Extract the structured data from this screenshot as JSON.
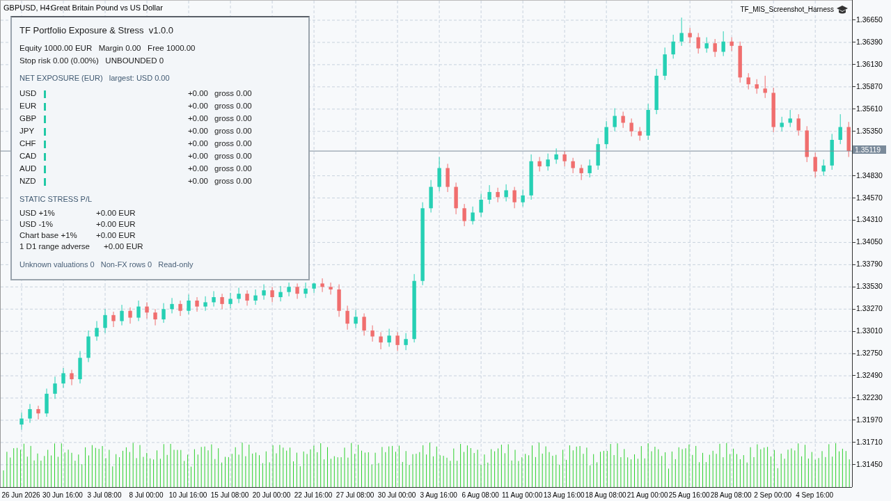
{
  "chart_header": {
    "symbol": "GBPUSD, H4:",
    "description": "Great Britain Pound vs US Dollar"
  },
  "expert": {
    "name": "TF_MIS_Screenshot_Harness"
  },
  "panel": {
    "title": "TF Portfolio Exposure & Stress  v1.0.0",
    "account_lines": [
      "Equity 1000.00 EUR   Margin 0.00   Free 1000.00",
      "Stop risk 0.00 (0.00%)   UNBOUNDED 0"
    ],
    "exposure_heading": "NET EXPOSURE (EUR)   largest: USD 0.00",
    "exposure_rows": [
      {
        "currency": "USD",
        "net": "+0.00",
        "gross": "gross 0.00"
      },
      {
        "currency": "EUR",
        "net": "+0.00",
        "gross": "gross 0.00"
      },
      {
        "currency": "GBP",
        "net": "+0.00",
        "gross": "gross 0.00"
      },
      {
        "currency": "JPY",
        "net": "+0.00",
        "gross": "gross 0.00"
      },
      {
        "currency": "CHF",
        "net": "+0.00",
        "gross": "gross 0.00"
      },
      {
        "currency": "CAD",
        "net": "+0.00",
        "gross": "gross 0.00"
      },
      {
        "currency": "AUD",
        "net": "+0.00",
        "gross": "gross 0.00"
      },
      {
        "currency": "NZD",
        "net": "+0.00",
        "gross": "gross 0.00"
      }
    ],
    "stress_heading": "STATIC STRESS P/L",
    "stress_rows": [
      {
        "scenario": "USD +1%",
        "pl": "+0.00 EUR"
      },
      {
        "scenario": "USD -1%",
        "pl": "+0.00 EUR"
      },
      {
        "scenario": "Chart base +1%",
        "pl": "+0.00 EUR"
      },
      {
        "scenario": "1 D1 range adverse",
        "pl": "+0.00 EUR"
      }
    ],
    "footer": "Unknown valuations 0   Non-FX rows 0   Read-only"
  },
  "chart_data": {
    "type": "candlestick",
    "categories": [
      "26 Jun 2026",
      null,
      null,
      null,
      null,
      "30 Jun 16:00",
      null,
      null,
      null,
      null,
      "3 Jul 08:00",
      null,
      null,
      null,
      null,
      "8 Jul 00:00",
      null,
      null,
      null,
      null,
      "10 Jul 16:00",
      null,
      null,
      null,
      null,
      "15 Jul 08:00",
      null,
      null,
      null,
      null,
      "20 Jul 00:00",
      null,
      null,
      null,
      null,
      "22 Jul 16:00",
      null,
      null,
      null,
      null,
      "27 Jul 08:00",
      null,
      null,
      null,
      null,
      "30 Jul 00:00",
      null,
      null,
      null,
      null,
      "3 Aug 16:00",
      null,
      null,
      null,
      null,
      "6 Aug 08:00",
      null,
      null,
      null,
      null,
      "11 Aug 00:00",
      null,
      null,
      null,
      null,
      "13 Aug 16:00",
      null,
      null,
      null,
      null,
      "18 Aug 08:00",
      null,
      null,
      null,
      null,
      "21 Aug 00:00",
      null,
      null,
      null,
      null,
      "25 Aug 16:00",
      null,
      null,
      null,
      null,
      "28 Aug 08:00",
      null,
      null,
      null,
      null,
      "2 Sep 00:00",
      null,
      null,
      null,
      null,
      "4 Sep 16:00",
      null,
      null,
      null,
      null
    ],
    "ohlc": [
      [
        1.3192,
        1.3206,
        1.3186,
        1.3199
      ],
      [
        1.3199,
        1.3216,
        1.3194,
        1.321
      ],
      [
        1.321,
        1.3214,
        1.3198,
        1.3205
      ],
      [
        1.3205,
        1.3234,
        1.3201,
        1.3228
      ],
      [
        1.3228,
        1.3248,
        1.3222,
        1.324
      ],
      [
        1.324,
        1.3258,
        1.3235,
        1.3252
      ],
      [
        1.3252,
        1.3256,
        1.3238,
        1.3245
      ],
      [
        1.3245,
        1.3278,
        1.324,
        1.327
      ],
      [
        1.327,
        1.3302,
        1.3265,
        1.3295
      ],
      [
        1.3295,
        1.3313,
        1.329,
        1.3305
      ],
      [
        1.3305,
        1.3327,
        1.3299,
        1.332
      ],
      [
        1.332,
        1.3324,
        1.3306,
        1.3313
      ],
      [
        1.3313,
        1.3332,
        1.3308,
        1.3325
      ],
      [
        1.3325,
        1.3329,
        1.331,
        1.3317
      ],
      [
        1.3317,
        1.3337,
        1.3313,
        1.333
      ],
      [
        1.333,
        1.3335,
        1.3316,
        1.3323
      ],
      [
        1.3323,
        1.3327,
        1.3308,
        1.3315
      ],
      [
        1.3315,
        1.3334,
        1.3311,
        1.3327
      ],
      [
        1.3327,
        1.334,
        1.3322,
        1.3333
      ],
      [
        1.3333,
        1.3337,
        1.3319,
        1.3325
      ],
      [
        1.3325,
        1.3344,
        1.3321,
        1.3337
      ],
      [
        1.3337,
        1.3341,
        1.3324,
        1.333
      ],
      [
        1.333,
        1.3342,
        1.3325,
        1.3335
      ],
      [
        1.3335,
        1.3348,
        1.333,
        1.3341
      ],
      [
        1.3341,
        1.3345,
        1.3327,
        1.3333
      ],
      [
        1.3333,
        1.3346,
        1.3328,
        1.3339
      ],
      [
        1.3339,
        1.3352,
        1.3334,
        1.3345
      ],
      [
        1.3345,
        1.3349,
        1.3331,
        1.3337
      ],
      [
        1.3337,
        1.335,
        1.3332,
        1.3343
      ],
      [
        1.3343,
        1.3356,
        1.3338,
        1.3349
      ],
      [
        1.3349,
        1.3353,
        1.3335,
        1.3341
      ],
      [
        1.3341,
        1.3354,
        1.3336,
        1.3347
      ],
      [
        1.3347,
        1.3358,
        1.3342,
        1.3353
      ],
      [
        1.3353,
        1.3357,
        1.3339,
        1.3345
      ],
      [
        1.3345,
        1.3358,
        1.334,
        1.3351
      ],
      [
        1.3351,
        1.3358,
        1.3346,
        1.3357
      ],
      [
        1.3357,
        1.3363,
        1.3347,
        1.3353
      ],
      [
        1.3353,
        1.3358,
        1.3344,
        1.335
      ],
      [
        1.335,
        1.3356,
        1.3318,
        1.3325
      ],
      [
        1.3325,
        1.3331,
        1.3303,
        1.331
      ],
      [
        1.331,
        1.3326,
        1.3305,
        1.3318
      ],
      [
        1.3318,
        1.3322,
        1.3296,
        1.3302
      ],
      [
        1.3302,
        1.3308,
        1.3289,
        1.3295
      ],
      [
        1.3295,
        1.33,
        1.328,
        1.3288
      ],
      [
        1.3288,
        1.3304,
        1.3283,
        1.3296
      ],
      [
        1.3296,
        1.33,
        1.3278,
        1.3285
      ],
      [
        1.3285,
        1.3299,
        1.3279,
        1.3292
      ],
      [
        1.3292,
        1.3368,
        1.3288,
        1.336
      ],
      [
        1.336,
        1.3452,
        1.3355,
        1.3445
      ],
      [
        1.3445,
        1.3478,
        1.344,
        1.347
      ],
      [
        1.347,
        1.3505,
        1.3465,
        1.3492
      ],
      [
        1.3492,
        1.3497,
        1.3464,
        1.347
      ],
      [
        1.347,
        1.3475,
        1.3438,
        1.3445
      ],
      [
        1.3445,
        1.345,
        1.3424,
        1.343
      ],
      [
        1.343,
        1.3447,
        1.3426,
        1.344
      ],
      [
        1.344,
        1.3462,
        1.3435,
        1.3455
      ],
      [
        1.3455,
        1.3472,
        1.345,
        1.3464
      ],
      [
        1.3464,
        1.3469,
        1.3452,
        1.3458
      ],
      [
        1.3458,
        1.3473,
        1.3453,
        1.3466
      ],
      [
        1.3466,
        1.347,
        1.3445,
        1.3452
      ],
      [
        1.3452,
        1.3467,
        1.3447,
        1.346
      ],
      [
        1.346,
        1.3508,
        1.3455,
        1.35
      ],
      [
        1.35,
        1.3505,
        1.3488,
        1.3494
      ],
      [
        1.3494,
        1.3509,
        1.3489,
        1.3502
      ],
      [
        1.3502,
        1.3515,
        1.3497,
        1.3508
      ],
      [
        1.3508,
        1.3512,
        1.3494,
        1.35
      ],
      [
        1.35,
        1.3504,
        1.3486,
        1.3492
      ],
      [
        1.3492,
        1.3496,
        1.3478,
        1.3486
      ],
      [
        1.3486,
        1.3502,
        1.3481,
        1.3495
      ],
      [
        1.3495,
        1.3527,
        1.349,
        1.352
      ],
      [
        1.352,
        1.3547,
        1.3515,
        1.354
      ],
      [
        1.354,
        1.3562,
        1.3535,
        1.3553
      ],
      [
        1.3553,
        1.3558,
        1.3539,
        1.3545
      ],
      [
        1.3545,
        1.355,
        1.3529,
        1.3535
      ],
      [
        1.3535,
        1.354,
        1.3524,
        1.353
      ],
      [
        1.353,
        1.3567,
        1.3525,
        1.356
      ],
      [
        1.356,
        1.3608,
        1.3555,
        1.36
      ],
      [
        1.36,
        1.3633,
        1.3595,
        1.3625
      ],
      [
        1.3625,
        1.3648,
        1.362,
        1.364
      ],
      [
        1.364,
        1.3668,
        1.3635,
        1.365
      ],
      [
        1.365,
        1.3656,
        1.3638,
        1.3645
      ],
      [
        1.3645,
        1.365,
        1.3626,
        1.3632
      ],
      [
        1.3632,
        1.3645,
        1.3627,
        1.3638
      ],
      [
        1.3638,
        1.3643,
        1.3622,
        1.3628
      ],
      [
        1.3628,
        1.3652,
        1.3623,
        1.364
      ],
      [
        1.364,
        1.3645,
        1.3629,
        1.3635
      ],
      [
        1.3635,
        1.364,
        1.3592,
        1.3598
      ],
      [
        1.3598,
        1.3603,
        1.3584,
        1.359
      ],
      [
        1.359,
        1.3596,
        1.3579,
        1.3585
      ],
      [
        1.3585,
        1.36,
        1.3574,
        1.358
      ],
      [
        1.358,
        1.3586,
        1.3534,
        1.354
      ],
      [
        1.354,
        1.3552,
        1.3535,
        1.3545
      ],
      [
        1.3545,
        1.356,
        1.354,
        1.355
      ],
      [
        1.355,
        1.3555,
        1.353,
        1.3536
      ],
      [
        1.3536,
        1.3541,
        1.3499,
        1.3505
      ],
      [
        1.3505,
        1.351,
        1.3481,
        1.3488
      ],
      [
        1.3488,
        1.3502,
        1.3483,
        1.3495
      ],
      [
        1.3495,
        1.3532,
        1.349,
        1.3525
      ],
      [
        1.3525,
        1.3555,
        1.352,
        1.354
      ],
      [
        1.354,
        1.3546,
        1.3505,
        1.3512
      ]
    ],
    "ylim": [
      1.3118,
      1.36878
    ],
    "yticks": [
      {
        "value": 1.3665,
        "label": "1.36650"
      },
      {
        "value": 1.3639,
        "label": "1.36390"
      },
      {
        "value": 1.3613,
        "label": "1.36130"
      },
      {
        "value": 1.3587,
        "label": "1.35870"
      },
      {
        "value": 1.3561,
        "label": "1.35610"
      },
      {
        "value": 1.3535,
        "label": "1.35350"
      },
      {
        "value": 1.3483,
        "label": "1.34830"
      },
      {
        "value": 1.3457,
        "label": "1.34570"
      },
      {
        "value": 1.3431,
        "label": "1.34310"
      },
      {
        "value": 1.3405,
        "label": "1.34050"
      },
      {
        "value": 1.3379,
        "label": "1.33790"
      },
      {
        "value": 1.3353,
        "label": "1.33530"
      },
      {
        "value": 1.3327,
        "label": "1.33270"
      },
      {
        "value": 1.3301,
        "label": "1.33010"
      },
      {
        "value": 1.3275,
        "label": "1.32750"
      },
      {
        "value": 1.3249,
        "label": "1.32490"
      },
      {
        "value": 1.3223,
        "label": "1.32230"
      },
      {
        "value": 1.3197,
        "label": "1.31970"
      },
      {
        "value": 1.3171,
        "label": "1.31710"
      },
      {
        "value": 1.3145,
        "label": "1.31450"
      }
    ],
    "grid": true,
    "ref_lines": [
      {
        "axis": "y",
        "value": 1.35119,
        "label": "1.35119"
      }
    ]
  }
}
